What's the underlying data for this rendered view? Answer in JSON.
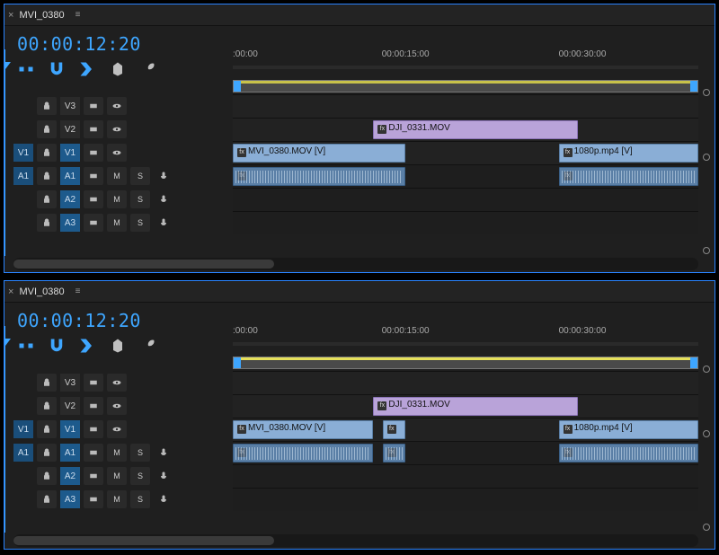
{
  "panels": [
    {
      "tab_title": "MVI_0380",
      "timecode": "00:00:12:20",
      "ruler": [
        {
          "x": 0,
          "label": ":00:00"
        },
        {
          "x": 32,
          "label": "00:00:15:00"
        },
        {
          "x": 70,
          "label": "00:00:30:00"
        }
      ],
      "playhead_pct": 32.2,
      "tracks": {
        "video": [
          {
            "id": "V3"
          },
          {
            "id": "V2"
          },
          {
            "id": "V1",
            "src": "V1"
          }
        ],
        "audio": [
          {
            "id": "A1",
            "src": "A1"
          },
          {
            "id": "A2"
          },
          {
            "id": "A3"
          }
        ]
      },
      "clips": [
        {
          "track": "V2",
          "type": "purple",
          "label": "DJI_0331.MOV",
          "start": 30.2,
          "width": 44
        },
        {
          "track": "V1",
          "type": "vid",
          "label": "MVI_0380.MOV [V]",
          "start": 0,
          "width": 37
        },
        {
          "track": "V1",
          "type": "vid",
          "label": "1080p.mp4 [V]",
          "start": 70,
          "width": 30
        },
        {
          "track": "A1",
          "type": "aud",
          "label": "",
          "start": 0,
          "width": 37
        },
        {
          "track": "A1",
          "type": "aud",
          "label": "",
          "start": 70,
          "width": 30
        }
      ],
      "track_btn": {
        "M": "M",
        "S": "S"
      },
      "hscroll": {
        "left": 0,
        "width": 38
      }
    },
    {
      "tab_title": "MVI_0380",
      "timecode": "00:00:12:20",
      "ruler": [
        {
          "x": 0,
          "label": ":00:00"
        },
        {
          "x": 32,
          "label": "00:00:15:00"
        },
        {
          "x": 70,
          "label": "00:00:30:00"
        }
      ],
      "playhead_pct": 32.2,
      "tracks": {
        "video": [
          {
            "id": "V3"
          },
          {
            "id": "V2"
          },
          {
            "id": "V1",
            "src": "V1"
          }
        ],
        "audio": [
          {
            "id": "A1",
            "src": "A1"
          },
          {
            "id": "A2"
          },
          {
            "id": "A3"
          }
        ]
      },
      "clips": [
        {
          "track": "V2",
          "type": "purple",
          "label": "DJI_0331.MOV",
          "start": 30.2,
          "width": 44
        },
        {
          "track": "V1",
          "type": "vid",
          "label": "MVI_0380.MOV [V]",
          "start": 0,
          "width": 30.2
        },
        {
          "track": "V1",
          "type": "vid",
          "label": "",
          "start": 32.2,
          "width": 4.8
        },
        {
          "track": "V1",
          "type": "vid",
          "label": "1080p.mp4 [V]",
          "start": 70,
          "width": 30
        },
        {
          "track": "A1",
          "type": "aud",
          "label": "",
          "start": 0,
          "width": 30.2
        },
        {
          "track": "A1",
          "type": "aud",
          "label": "",
          "start": 32.2,
          "width": 4.8
        },
        {
          "track": "A1",
          "type": "aud",
          "label": "",
          "start": 70,
          "width": 30
        }
      ],
      "track_btn": {
        "M": "M",
        "S": "S"
      },
      "hscroll": {
        "left": 0,
        "width": 38
      }
    }
  ],
  "icons": {
    "lock": "lock-icon",
    "sync": "sync-lock-icon",
    "eye": "eye-icon",
    "mic": "microphone-icon"
  }
}
